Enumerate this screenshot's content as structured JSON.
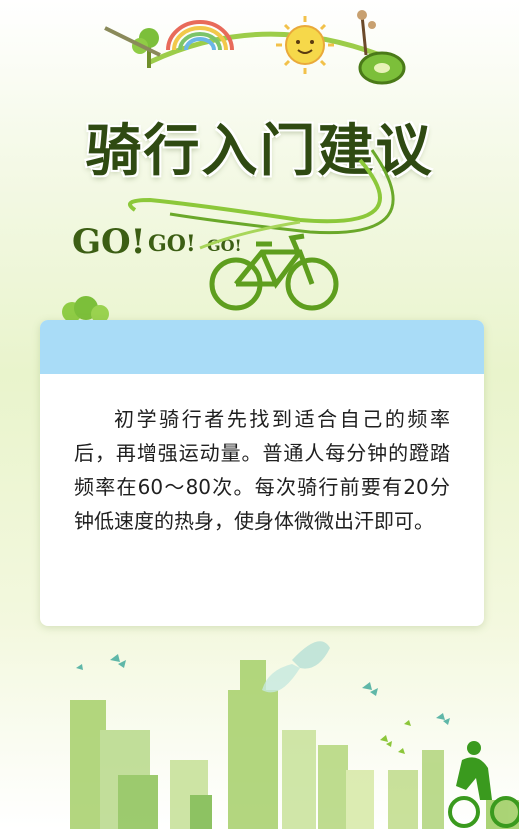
{
  "title": "骑行入门建议",
  "go": [
    "GO!",
    "GO!",
    "GO!"
  ],
  "tip": "初学骑行者先找到适合自己的频率后，再增强运动量。普通人每分钟的蹬踏频率在60～80次。每次骑行前要有20分钟低速度的热身，使身体微微出汗即可。",
  "colors": {
    "title": "#2f4a12",
    "card_header": "#a9dcf7",
    "leaf_green": "#7cbf3a",
    "sun": "#f6d84a"
  },
  "icons": [
    "rainbow-icon",
    "sun-icon",
    "kiwi-slice-icon",
    "bicycle-icon",
    "butterfly-icon",
    "tree-icon",
    "cyclist-icon"
  ]
}
